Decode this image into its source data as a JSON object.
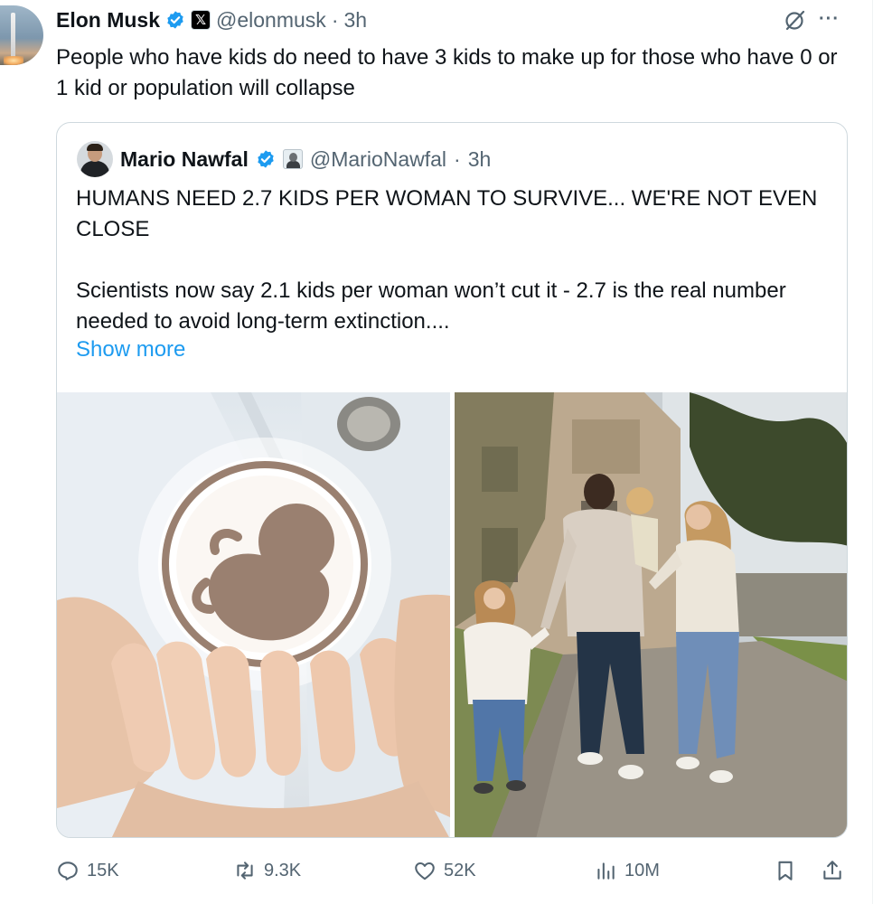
{
  "tweet": {
    "author_name": "Elon Musk",
    "handle": "@elonmusk",
    "separator": "·",
    "time": "3h",
    "text": "People who have kids do need to have 3 kids to make up for those who have 0 or 1 kid or population will collapse",
    "more_label": "···"
  },
  "quote": {
    "author_name": "Mario Nawfal",
    "handle": "@MarioNawfal",
    "separator": "·",
    "time": "3h",
    "headline": "HUMANS NEED 2.7 KIDS PER WOMAN TO SURVIVE... WE'RE NOT EVEN CLOSE",
    "body": "Scientists now say 2.1 kids per woman won’t cut it - 2.7 is the real number needed to avoid long-term extinction....",
    "show_more": "Show more",
    "images": [
      "fetus-in-hands-image",
      "family-walking-image"
    ]
  },
  "actions": {
    "replies": "15K",
    "reposts": "9.3K",
    "likes": "52K",
    "views": "10M"
  },
  "icons": {
    "verified": "verified-badge-icon",
    "x_affiliate": "x-logo-icon",
    "grok": "grok-icon",
    "reply": "reply-icon",
    "repost": "repost-icon",
    "like": "heart-icon",
    "views": "views-chart-icon",
    "bookmark": "bookmark-icon",
    "share": "share-icon"
  },
  "colors": {
    "verified_blue": "#1d9bf0",
    "link_blue": "#1d9bf0",
    "secondary_text": "#536471",
    "border": "#cfd9de"
  }
}
